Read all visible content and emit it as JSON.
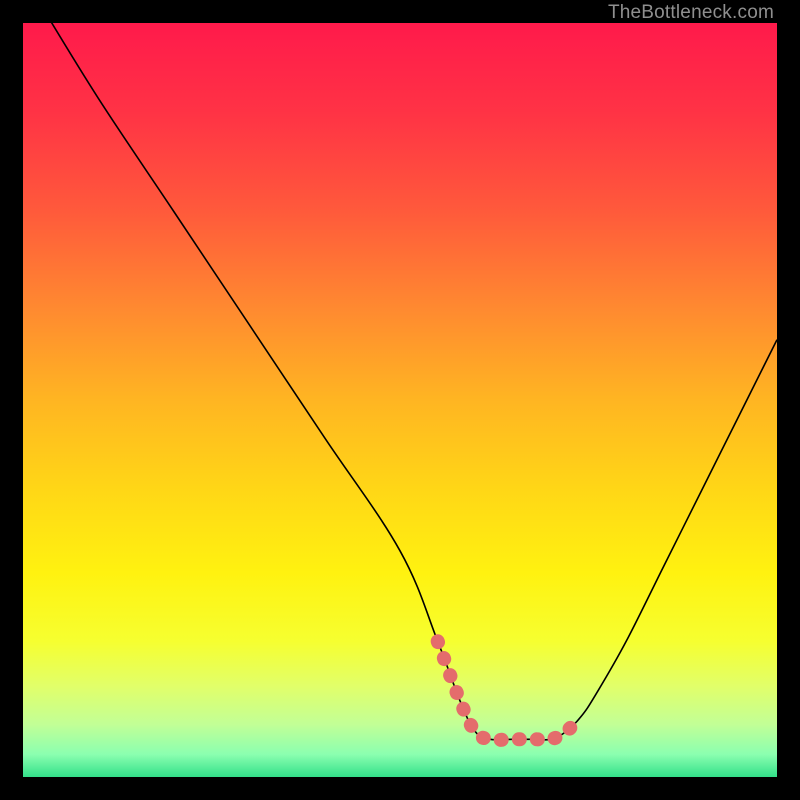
{
  "watermark": "TheBottleneck.com",
  "gradient_stops": [
    {
      "offset": 0.0,
      "color": "#ff1a4b"
    },
    {
      "offset": 0.12,
      "color": "#ff3345"
    },
    {
      "offset": 0.25,
      "color": "#ff5a3b"
    },
    {
      "offset": 0.38,
      "color": "#ff8a30"
    },
    {
      "offset": 0.5,
      "color": "#ffb522"
    },
    {
      "offset": 0.62,
      "color": "#ffd716"
    },
    {
      "offset": 0.73,
      "color": "#fff210"
    },
    {
      "offset": 0.82,
      "color": "#f6ff30"
    },
    {
      "offset": 0.88,
      "color": "#e1ff6a"
    },
    {
      "offset": 0.93,
      "color": "#c2ff96"
    },
    {
      "offset": 0.97,
      "color": "#8bffb0"
    },
    {
      "offset": 1.0,
      "color": "#33e08a"
    }
  ],
  "chart_data": {
    "type": "line",
    "title": "",
    "xlabel": "",
    "ylabel": "",
    "xlim": [
      0,
      100
    ],
    "ylim": [
      0,
      100
    ],
    "series": [
      {
        "name": "curve",
        "x": [
          2,
          10,
          20,
          30,
          40,
          50,
          55,
          58,
          60,
          62,
          65,
          68,
          70,
          72,
          74,
          76,
          80,
          85,
          90,
          95,
          100
        ],
        "values": [
          103,
          90,
          75,
          60,
          45,
          30,
          18,
          10,
          6,
          5,
          5,
          5,
          5,
          6,
          8,
          11,
          18,
          28,
          38,
          48,
          58
        ]
      }
    ],
    "highlight": {
      "name": "optimal-zone",
      "x": [
        55,
        74
      ],
      "y": [
        5,
        10
      ],
      "color": "#e46c6c"
    }
  }
}
